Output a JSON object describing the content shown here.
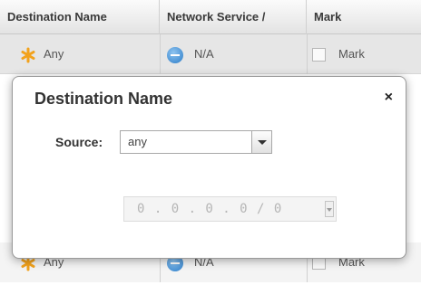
{
  "table": {
    "headers": [
      "Destination Name",
      "Network Service /",
      "Mark"
    ],
    "rows": [
      {
        "destination": "Any",
        "service": "N/A",
        "mark": "Mark"
      },
      {
        "destination": "Any",
        "service": "N/A",
        "mark": "Mark"
      }
    ]
  },
  "popup": {
    "title": "Destination Name",
    "close_glyph": "×",
    "source_label": "Source:",
    "source_value": "any",
    "ip_value": "0 . 0 . 0 . 0 / 0"
  },
  "colors": {
    "star": "#f2a21c",
    "service_icon": "#2b7cc8"
  },
  "icons": {
    "destination": "asterisk-star-icon",
    "service": "minus-circle-icon"
  }
}
